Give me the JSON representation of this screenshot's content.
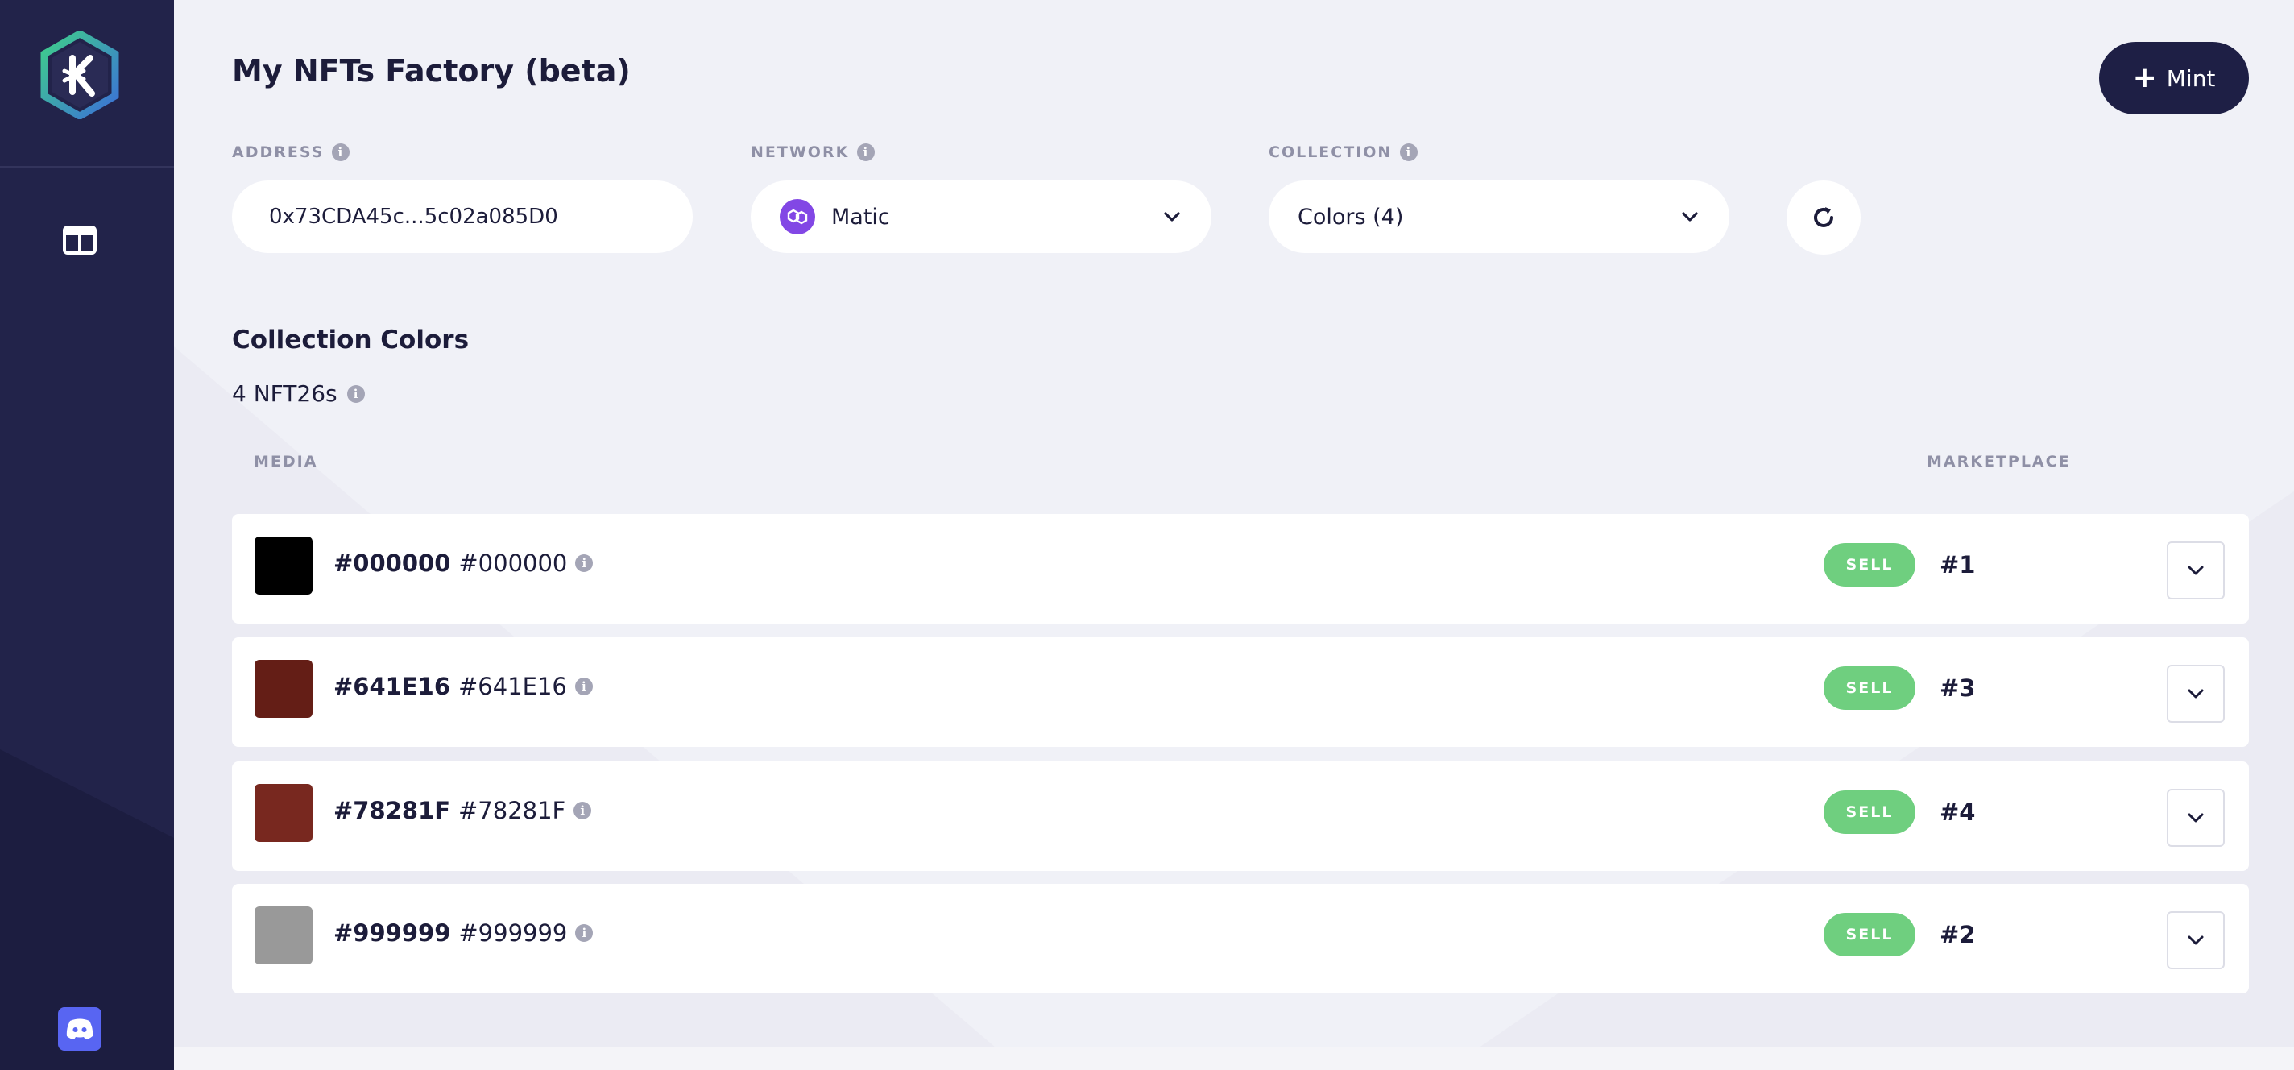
{
  "app": {
    "title": "My NFTs Factory (beta)",
    "mint_label": "Mint"
  },
  "sidebar": {
    "logo_icon": "hex-k-logo-icon",
    "nav_icon": "dashboard-icon",
    "discord_icon": "discord-icon"
  },
  "filters": {
    "address_label": "ADDRESS",
    "address_value": "0x73CDA45c...5c02a085D0",
    "network_label": "NETWORK",
    "network_value": "Matic",
    "collection_label": "COLLECTION",
    "collection_value": "Colors (4)"
  },
  "collection": {
    "title": "Collection Colors",
    "count": "4 NFT26s",
    "media_header": "MEDIA",
    "marketplace_header": "MARKETPLACE"
  },
  "items": [
    {
      "title": "#000000",
      "subtitle": "#000000",
      "color": "#000000",
      "sell": "SELL",
      "token": "#1"
    },
    {
      "title": "#641E16",
      "subtitle": "#641E16",
      "color": "#641E16",
      "sell": "SELL",
      "token": "#3"
    },
    {
      "title": "#78281F",
      "subtitle": "#78281F",
      "color": "#78281F",
      "sell": "SELL",
      "token": "#4"
    },
    {
      "title": "#999999",
      "subtitle": "#999999",
      "color": "#999999",
      "sell": "SELL",
      "token": "#2"
    }
  ],
  "colors": {
    "sidebar_bg": "#22234a",
    "primary": "#1e1f45",
    "sell_green": "#6fcf7f",
    "matic_purple": "#8247e5"
  }
}
